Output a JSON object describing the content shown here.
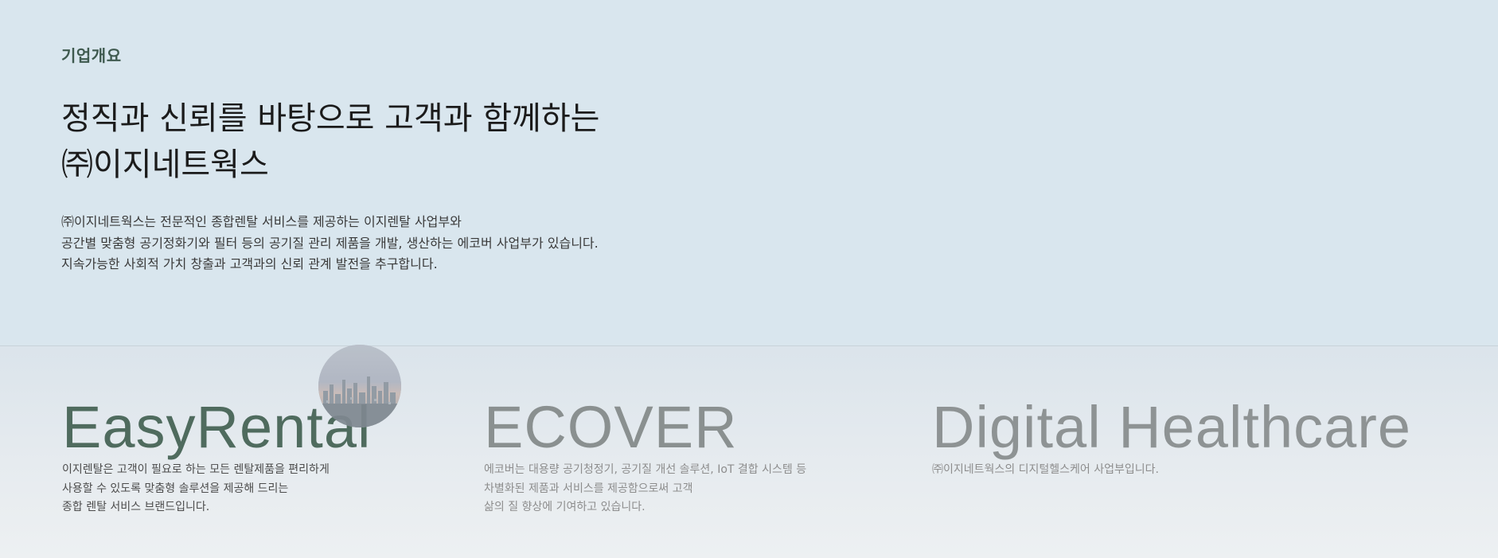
{
  "section": {
    "label": "기업개요"
  },
  "headline": {
    "line1": "정직과 신뢰를 바탕으로 고객과 함께하는",
    "line2": "㈜이지네트웍스"
  },
  "intro": {
    "lines": [
      "㈜이지네트웍스는 전문적인 종합렌탈 서비스를 제공하는 이지렌탈 사업부와",
      "공간별 맞춤형 공기정화기와 필터 등의 공기질 관리 제품을 개발, 생산하는 에코버 사업부가 있습니다.",
      "지속가능한 사회적 가치 창출과 고객과의 신뢰 관계 발전을 추구합니다."
    ]
  },
  "brands": [
    {
      "name": "EasyRental",
      "description": [
        "이지렌탈은 고객이 필요로 하는 모든 렌탈제품을 편리하게",
        "사용할 수 있도록 맞춤형 솔루션을 제공해 드리는",
        "종합 렌탈 서비스 브랜드입니다."
      ]
    },
    {
      "name": "ECOVER",
      "description": [
        "에코버는 대용량 공기청정기, 공기질 개선 솔루션, IoT 결합 시스템 등",
        "차별화된 제품과 서비스를 제공함으로써 고객",
        "삶의 질 향상에 기여하고 있습니다."
      ]
    },
    {
      "name": "Digital Healthcare",
      "description": [
        "㈜이지네트웍스의 디지털헬스케어 사업부입니다."
      ]
    }
  ],
  "icons": {
    "city_image": "city-skyline-photo"
  },
  "colors": {
    "top_background": "#d9e6ee",
    "active_brand": "#4f6b5e",
    "inactive_brand": "#8a9090",
    "label": "#3f5a4f"
  }
}
